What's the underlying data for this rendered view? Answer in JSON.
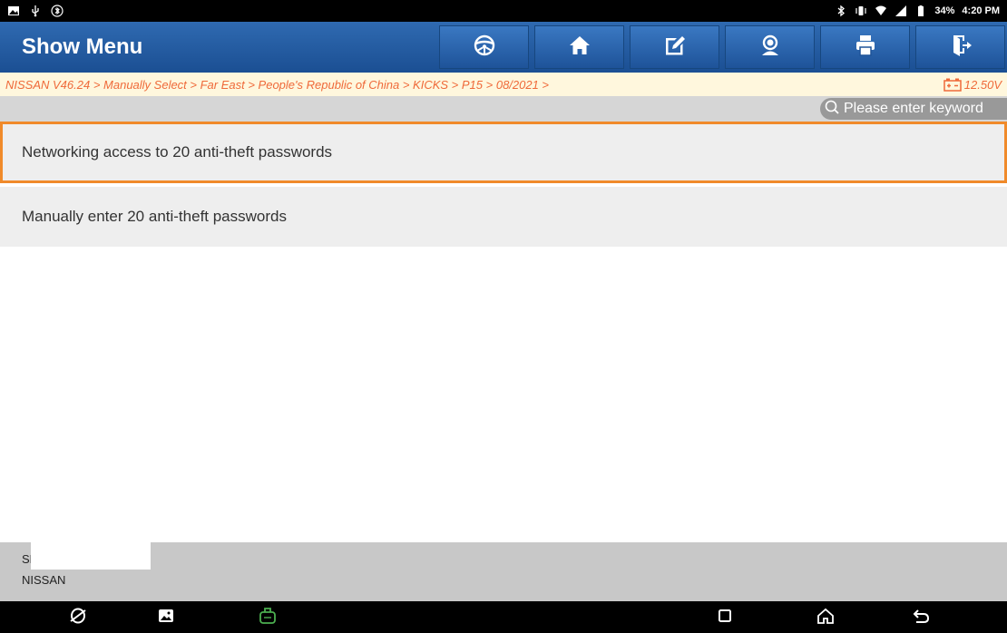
{
  "status_bar": {
    "left_icons": [
      "image-icon",
      "usb-icon",
      "bluetooth-circle-icon"
    ],
    "right_icons": [
      "bluetooth-icon",
      "vibrate-icon",
      "wifi-icon",
      "signal-icon",
      "battery-icon"
    ],
    "battery_percent": "34%",
    "time": "4:20 PM"
  },
  "header": {
    "title": "Show Menu",
    "toolbar": [
      {
        "icon": "steering-wheel-icon"
      },
      {
        "icon": "home-icon"
      },
      {
        "icon": "edit-icon"
      },
      {
        "icon": "remote-support-icon"
      },
      {
        "icon": "print-icon"
      },
      {
        "icon": "exit-icon"
      }
    ]
  },
  "breadcrumb": {
    "path": "NISSAN V46.24 > Manually Select > Far East > People's Republic of China > KICKS > P15 > 08/2021 >",
    "voltage": "12.50V"
  },
  "search": {
    "placeholder": "Please enter keyword"
  },
  "menu": {
    "items": [
      {
        "label": "Networking access to 20 anti-theft passwords",
        "selected": true
      },
      {
        "label": "Manually enter 20 anti-theft passwords",
        "selected": false
      }
    ]
  },
  "footer": {
    "sn_label": "SN:",
    "brand": "NISSAN"
  },
  "nav_bar": {
    "left_icons": [
      "browser-icon",
      "gallery-icon",
      "vci-icon"
    ],
    "right_icons": [
      "recent-apps-icon",
      "home-icon",
      "back-icon"
    ]
  },
  "colors": {
    "title_bar": "#1f5599",
    "breadcrumb_text": "#ef6a3a",
    "selected_border": "#f08a2a",
    "vci_icon": "#4caf50"
  }
}
